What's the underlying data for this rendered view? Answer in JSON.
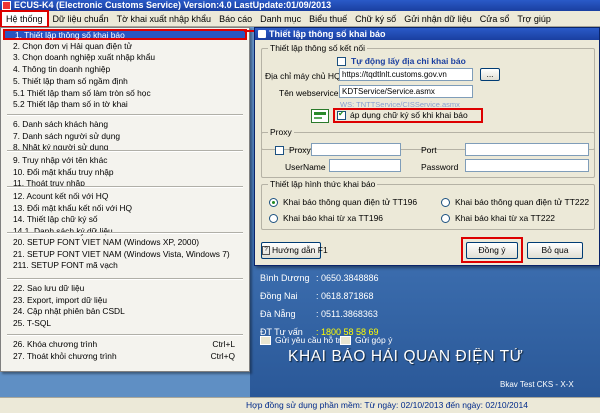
{
  "window": {
    "title": "ECUS-K4 (Electronic Customs Service) Version:4.0 LastUpdate:01/09/2013"
  },
  "menubar": [
    "Hệ thống",
    "Dữ liệu chuẩn",
    "Tờ khai xuất nhập khẩu",
    "Báo cáo",
    "Danh mục",
    "Biểu thuế",
    "Chữ ký số",
    "Gửi nhận dữ liệu",
    "Cửa sổ",
    "Trợ giúp"
  ],
  "dropdown": {
    "groups": [
      [
        {
          "label": "1. Thiết lập thông số khai báo",
          "selected": true
        },
        {
          "label": "2. Chọn đơn vị Hải quan điện tử"
        },
        {
          "label": "3. Chọn doanh nghiệp xuất nhập khẩu"
        },
        {
          "label": "4. Thông tin doanh nghiệp"
        },
        {
          "label": "5. Thiết lập tham số ngầm định"
        },
        {
          "label": "5.1 Thiết lập tham số làm tròn số học"
        },
        {
          "label": "5.2 Thiết lập tham số in tờ khai"
        }
      ],
      [
        {
          "label": "6. Danh sách khách hàng"
        },
        {
          "label": "7. Danh sách người sử dụng"
        },
        {
          "label": "8. Nhật ký người sử dụng"
        }
      ],
      [
        {
          "label": "9. Truy nhập với tên khác"
        },
        {
          "label": "10. Đổi mật khẩu truy nhập"
        },
        {
          "label": "11. Thoát truy nhập"
        }
      ],
      [
        {
          "label": "12. Acount kết nối với HQ"
        },
        {
          "label": "13. Đổi mật khẩu kết nối với HQ"
        },
        {
          "label": "14. Thiết lập chữ ký số"
        },
        {
          "label": "14.1. Danh sách ký dữ liệu"
        }
      ],
      [
        {
          "label": "20. SETUP FONT VIET NAM (Windows XP, 2000)"
        },
        {
          "label": "21. SETUP FONT VIET NAM (Windows Vista, Windows 7)"
        },
        {
          "label": "211. SETUP FONT mã vạch"
        }
      ],
      [
        {
          "label": "22. Sao lưu dữ liệu"
        },
        {
          "label": "23. Export, import dữ liệu"
        },
        {
          "label": "24. Cập nhật phiên bản CSDL"
        },
        {
          "label": "25. T-SQL"
        }
      ],
      [
        {
          "label": "26. Khóa chương trình",
          "shortcut": "Ctrl+L"
        },
        {
          "label": "27. Thoát khỏi chương trình",
          "shortcut": "Ctrl+Q"
        }
      ]
    ]
  },
  "dialog": {
    "title": "Thiết lập thông số khai báo",
    "connection": {
      "group_title": "Thiết lập thông số kết nối",
      "auto_detect_label": "Tự động lấy địa chỉ khai báo",
      "address_label": "Địa chỉ máy chủ HQ:",
      "address_value": "https://tqdtlnlt.customs.gov.vn",
      "browse_label": "...",
      "webservice_label": "Tên webservice:",
      "webservice_value": "KDTService/Service.asmx",
      "ghost_text": "WS: TNTTService/CISService.asmx",
      "sign_label": "áp dụng chữ ký số khi khai báo",
      "sign_checked": true
    },
    "proxy": {
      "group_title": "Proxy",
      "proxy_label": "Proxy",
      "port_label": "Port",
      "username_label": "UserName",
      "password_label": "Password"
    },
    "method": {
      "group_title": "Thiết lập hình thức khai báo",
      "options": [
        {
          "label": "Khai báo thông quan điện tử TT196",
          "selected": true
        },
        {
          "label": "Khai báo thông quan điện tử TT222",
          "selected": false
        },
        {
          "label": "Khai báo khai từ xa TT196",
          "selected": false
        },
        {
          "label": "Khai báo khai từ xa TT222",
          "selected": false
        }
      ]
    },
    "help_label": "Hướng dẫn F1",
    "ok_label": "Đồng ý",
    "skip_label": "Bỏ qua"
  },
  "background": {
    "contacts": [
      {
        "label": "Bình Dương",
        "value": ": 0650.3848886"
      },
      {
        "label": "Đồng Nai",
        "value": ": 0618.871868"
      },
      {
        "label": "Đà Nẵng",
        "value": ": 0511.3868363"
      },
      {
        "label": "ĐT Tư vấn",
        "value": ": 1800 58 58 69",
        "highlight": true
      }
    ],
    "links": [
      "Gửi yêu cầu hỗ trợ",
      "Gửi góp ý"
    ],
    "banner": "KHAI BÁO HẢI QUAN ĐIỆN TỬ",
    "bkav": "Bkav Test CKS - X-X"
  },
  "statusbar": {
    "text": "Hợp đồng sử dụng phần mềm: Từ ngày: 02/10/2013 đến ngày: 02/10/2014"
  },
  "colors": {
    "title_bar": "#1a3fa0",
    "selection": "#2a55c0",
    "highlight_box": "#dd0000",
    "desktop_bg": "#5f8fc4"
  }
}
